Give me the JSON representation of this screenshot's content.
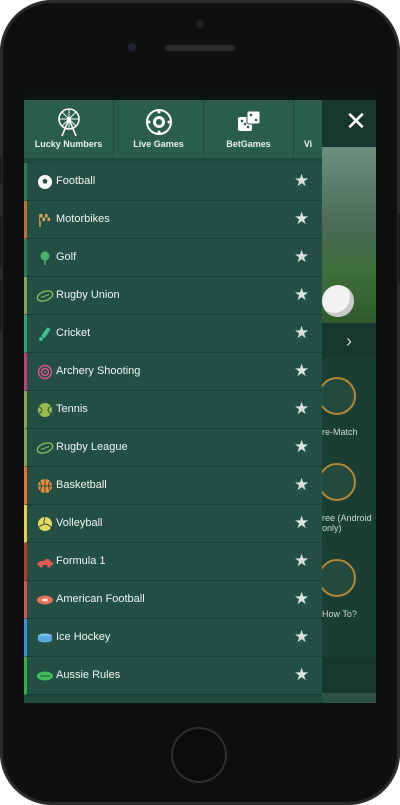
{
  "device": {
    "type": "smartphone"
  },
  "drawer": {
    "top_nav": [
      {
        "label": "Lucky Numbers",
        "icon": "ferris-wheel-icon"
      },
      {
        "label": "Live Games",
        "icon": "roulette-wheel-icon"
      },
      {
        "label": "BetGames",
        "icon": "dice-icon"
      },
      {
        "label": "Vi",
        "icon": "virtual-icon"
      }
    ],
    "sports": [
      {
        "label": "Football",
        "icon": "football-icon",
        "accent": "#2e7d5a"
      },
      {
        "label": "Motorbikes",
        "icon": "chequered-flag-icon",
        "accent": "#b7742e"
      },
      {
        "label": "Golf",
        "icon": "golf-icon",
        "accent": "#2e7d5a"
      },
      {
        "label": "Rugby Union",
        "icon": "rugby-ball-icon",
        "accent": "#7fa64a"
      },
      {
        "label": "Cricket",
        "icon": "cricket-icon",
        "accent": "#2aa57a"
      },
      {
        "label": "Archery Shooting",
        "icon": "target-icon",
        "accent": "#c23b7c"
      },
      {
        "label": "Tennis",
        "icon": "tennis-ball-icon",
        "accent": "#8aa64a"
      },
      {
        "label": "Rugby League",
        "icon": "rugby-ball-icon",
        "accent": "#7fa64a"
      },
      {
        "label": "Basketball",
        "icon": "basketball-icon",
        "accent": "#e0772b"
      },
      {
        "label": "Volleyball",
        "icon": "volleyball-icon",
        "accent": "#e1d24a"
      },
      {
        "label": "Formula 1",
        "icon": "race-car-icon",
        "accent": "#c0392b"
      },
      {
        "label": "American Football",
        "icon": "american-football-icon",
        "accent": "#d9534f"
      },
      {
        "label": "Ice Hockey",
        "icon": "hockey-puck-icon",
        "accent": "#3a8fd9"
      },
      {
        "label": "Aussie Rules",
        "icon": "aussie-rules-ball-icon",
        "accent": "#2fae4c"
      }
    ],
    "visible_partial_last_label": "Rules"
  },
  "background": {
    "promo_texts": [
      "re-Match",
      "ree (Android",
      "only)",
      "How To?"
    ]
  },
  "help": {
    "icon": "question-mark-icon"
  }
}
